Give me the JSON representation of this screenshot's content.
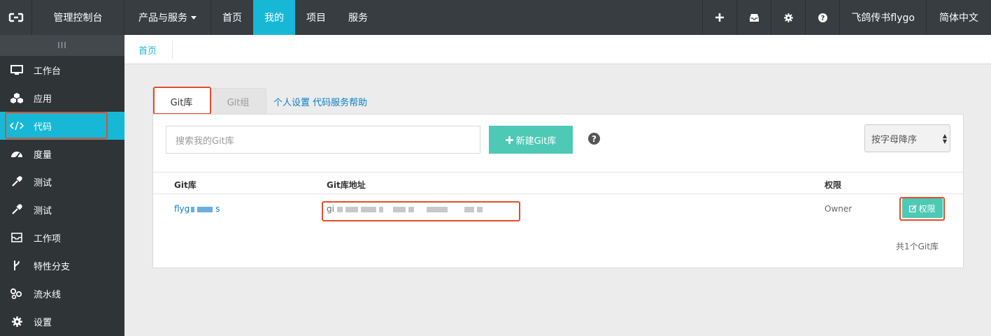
{
  "topbar": {
    "console": "管理控制台",
    "nav": [
      "产品与服务",
      "首页",
      "我的",
      "项目",
      "服务"
    ],
    "active_index": 2,
    "user": "飞鸽传书flygo",
    "lang": "简体中文",
    "icons": [
      "plus-icon",
      "inbox-icon",
      "gear-icon",
      "question-icon"
    ]
  },
  "sidebar": {
    "toggle": "III",
    "items": [
      {
        "label": "工作台",
        "icon": "monitor-icon"
      },
      {
        "label": "应用",
        "icon": "cubes-icon"
      },
      {
        "label": "代码",
        "icon": "code-icon"
      },
      {
        "label": "度量",
        "icon": "dashboard-icon"
      },
      {
        "label": "测试",
        "icon": "eyedropper-icon"
      },
      {
        "label": "测试",
        "icon": "eyedropper-icon"
      },
      {
        "label": "工作项",
        "icon": "inbox-icon"
      },
      {
        "label": "特性分支",
        "icon": "branch-icon"
      },
      {
        "label": "流水线",
        "icon": "pipeline-icon"
      },
      {
        "label": "设置",
        "icon": "gear-icon"
      }
    ],
    "active_index": 2
  },
  "breadcrumb": "首页",
  "tabs": {
    "active": "Git库",
    "inactive": "Git组",
    "link": "个人设置 代码服务帮助"
  },
  "toolbar": {
    "search_placeholder": "搜索我的Git库",
    "new_button": "新建Git库",
    "help": "?",
    "sort": "按字母降序"
  },
  "table": {
    "headers": [
      "Git库",
      "Git库地址",
      "权限"
    ],
    "rows": [
      {
        "name_prefix": "flyg",
        "name_suffix": "s",
        "url_prefix": "gi",
        "permission": "Owner",
        "action": "权限"
      }
    ]
  },
  "footer_total": "共1个Git库",
  "colors": {
    "accent": "#17b8d6",
    "teal": "#4dc9b5",
    "highlight": "#e34d2a",
    "link": "#0a80c7"
  }
}
